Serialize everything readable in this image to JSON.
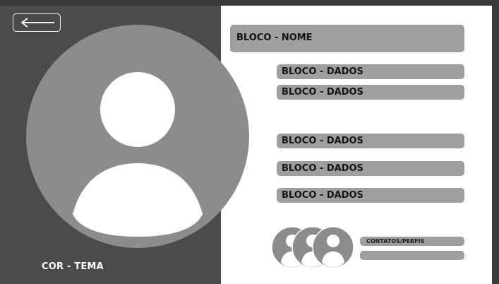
{
  "colors": {
    "background": "#353535",
    "left_panel": "#4b4b4b",
    "right_panel": "#ffffff",
    "block": "#9f9f9f",
    "avatar_circle": "#8c8c8c"
  },
  "header": {
    "back_icon": "arrow-left-icon"
  },
  "profile": {
    "avatar_icon": "user-silhouette-icon",
    "theme_label": "COR - TEMA"
  },
  "blocks": {
    "name": "BLOCO - NOME",
    "data": [
      "BLOCO - DADOS",
      "BLOCO - DADOS",
      "BLOCO - DADOS",
      "BLOCO - DADOS",
      "BLOCO - DADOS"
    ]
  },
  "contacts": {
    "label": "CONTATOS/PERFIS",
    "avatar_icon": "user-avatar-icon"
  }
}
